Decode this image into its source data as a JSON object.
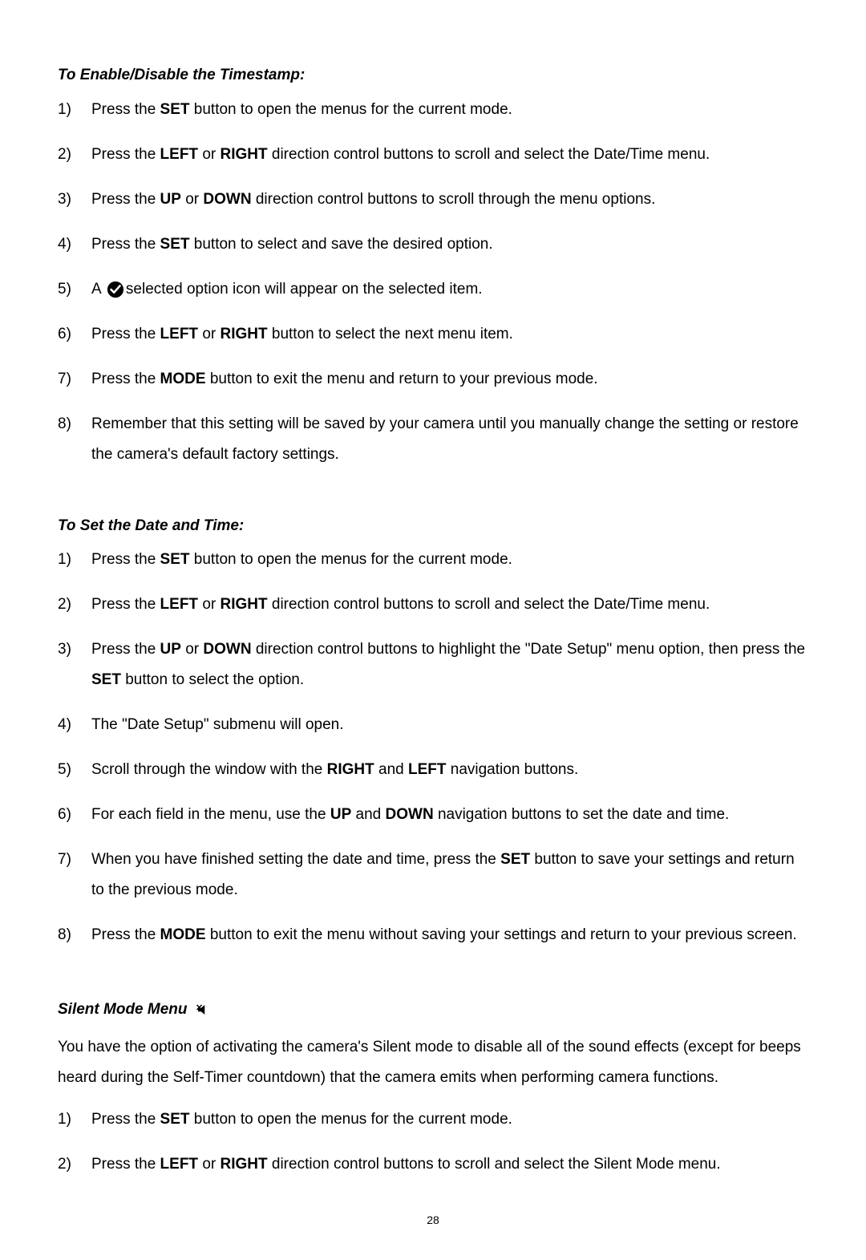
{
  "section1": {
    "title": "To Enable/Disable the Timestamp:",
    "steps": [
      {
        "pre": "Press the ",
        "b1": "SET",
        "post": " button to open the menus for the current mode."
      },
      {
        "pre": "Press the ",
        "b1": "LEFT",
        "mid1": " or ",
        "b2": "RIGHT",
        "post": " direction control buttons to scroll and select the Date/Time menu."
      },
      {
        "pre": "Press the ",
        "b1": "UP",
        "mid1": " or ",
        "b2": "DOWN",
        "post": " direction control buttons to scroll through the menu options."
      },
      {
        "pre": "Press the ",
        "b1": "SET",
        "post": " button to select and save the desired option."
      },
      {
        "pre": "A ",
        "icon": true,
        "post": "selected option icon will appear on the selected item."
      },
      {
        "pre": "Press the ",
        "b1": "LEFT",
        "mid1": " or ",
        "b2": "RIGHT",
        "post": " button to select the next menu item."
      },
      {
        "pre": "Press the ",
        "b1": "MODE",
        "post": " button to exit the menu and return to your previous mode."
      },
      {
        "pre": "Remember that this setting will be saved by your camera until you manually change the setting or restore the camera's default factory settings."
      }
    ]
  },
  "section2": {
    "title": "To Set the Date and Time:",
    "steps": [
      {
        "pre": "Press the ",
        "b1": "SET",
        "post": " button to open the menus for the current mode."
      },
      {
        "pre": "Press the ",
        "b1": "LEFT",
        "mid1": " or ",
        "b2": "RIGHT",
        "post": " direction control buttons to scroll and select the Date/Time menu."
      },
      {
        "pre": "Press the ",
        "b1": "UP",
        "mid1": " or ",
        "b2": "DOWN",
        "post": " direction control buttons to highlight the \"Date Setup\" menu option, then press the ",
        "b3": "SET",
        "post2": " button to select the option."
      },
      {
        "pre": "The \"Date Setup\" submenu will open."
      },
      {
        "pre": "Scroll through the window with the ",
        "b1": "RIGHT",
        "mid1": " and ",
        "b2": "LEFT",
        "post": " navigation buttons."
      },
      {
        "pre": "For each field in the menu, use the ",
        "b1": "UP",
        "mid1": " and ",
        "b2": "DOWN",
        "post": " navigation buttons to set the date and time."
      },
      {
        "pre": "When you have finished setting the date and time, press the ",
        "b1": "SET",
        "post": " button to save your settings and return to the previous mode."
      },
      {
        "pre": "Press the ",
        "b1": "MODE",
        "post": " button to exit the menu without saving your settings and return to your previous screen."
      }
    ]
  },
  "section3": {
    "title": "Silent Mode Menu",
    "intro": "You have the option of activating the camera's Silent mode to disable all of the sound effects (except for beeps heard during the Self-Timer countdown) that the camera emits when performing camera functions.",
    "steps": [
      {
        "pre": "Press the ",
        "b1": "SET",
        "post": " button to open the menus for the current mode."
      },
      {
        "pre": "Press the ",
        "b1": "LEFT",
        "mid1": " or ",
        "b2": "RIGHT",
        "post": " direction control buttons to scroll and select the Silent Mode menu."
      }
    ]
  },
  "pageNumber": "28"
}
